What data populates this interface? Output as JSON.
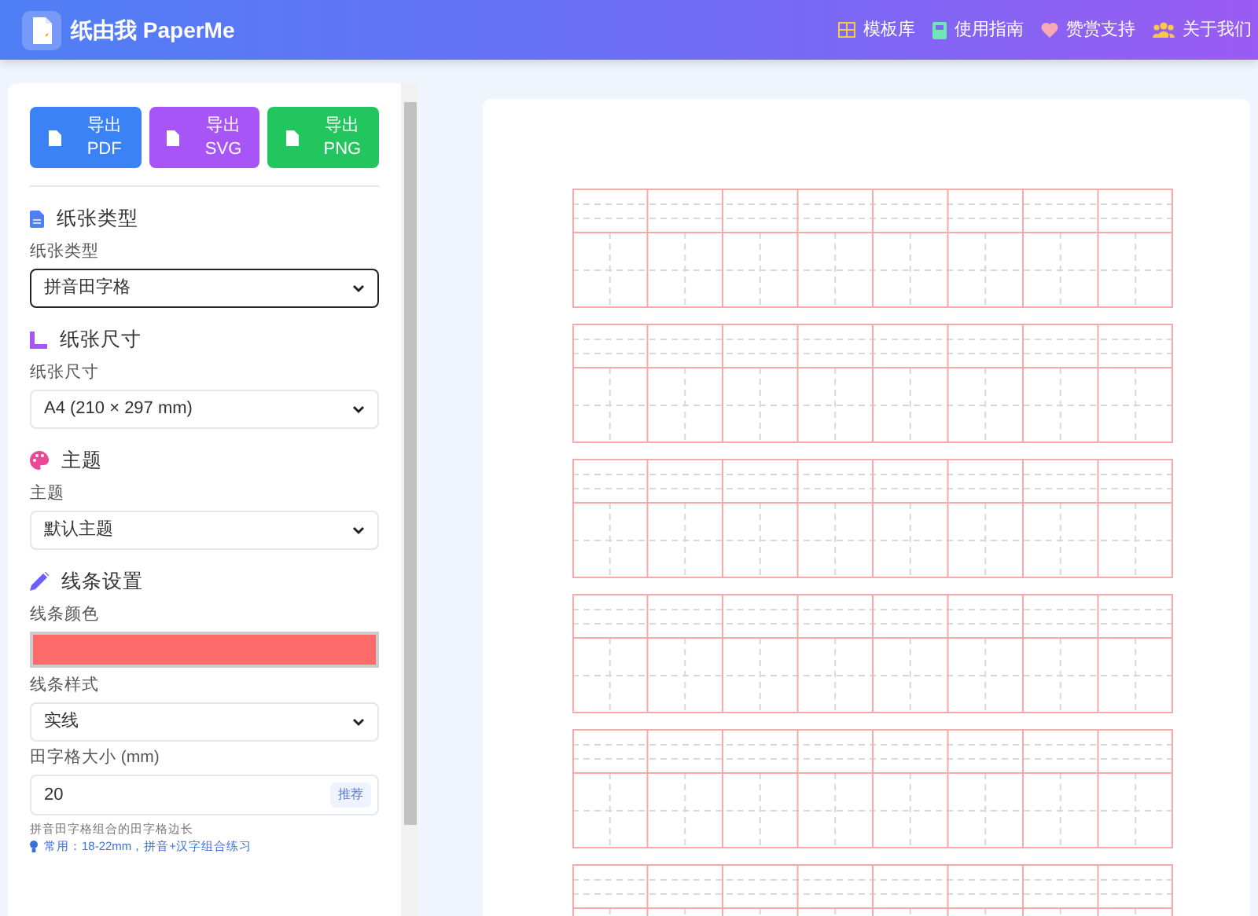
{
  "brand": {
    "title": "纸由我 PaperMe"
  },
  "nav_items": [
    {
      "label": "模板库"
    },
    {
      "label": "使用指南"
    },
    {
      "label": "赞赏支持"
    },
    {
      "label": "关于我们"
    }
  ],
  "export_buttons": [
    {
      "label": "导出",
      "format": "PDF",
      "color": "#3b82f6"
    },
    {
      "label": "导出",
      "format": "SVG",
      "color": "#a855f7"
    },
    {
      "label": "导出",
      "format": "PNG",
      "color": "#22c55e"
    }
  ],
  "sections": [
    {
      "title": "纸张类型",
      "fields": [
        {
          "kind": "select",
          "label": "纸张类型",
          "value": "拼音田字格",
          "focused": true
        }
      ]
    },
    {
      "title": "纸张尺寸",
      "fields": [
        {
          "kind": "select",
          "label": "纸张尺寸",
          "value": "A4 (210 × 297 mm)",
          "focused": false
        }
      ]
    },
    {
      "title": "主题",
      "fields": [
        {
          "kind": "select",
          "label": "主题",
          "value": "默认主题",
          "focused": false
        }
      ]
    },
    {
      "title": "线条设置",
      "fields": [
        {
          "kind": "color",
          "label": "线条颜色",
          "color": "#ff6b6b"
        },
        {
          "kind": "select",
          "label": "线条样式",
          "value": "实线",
          "focused": false
        },
        {
          "kind": "number",
          "label": "田字格大小 (mm)",
          "value": "20",
          "badge": "推荐",
          "help": "拼音田字格组合的田字格边长",
          "tip": "常用：18-22mm，拼音+汉字组合练习"
        }
      ]
    }
  ]
}
